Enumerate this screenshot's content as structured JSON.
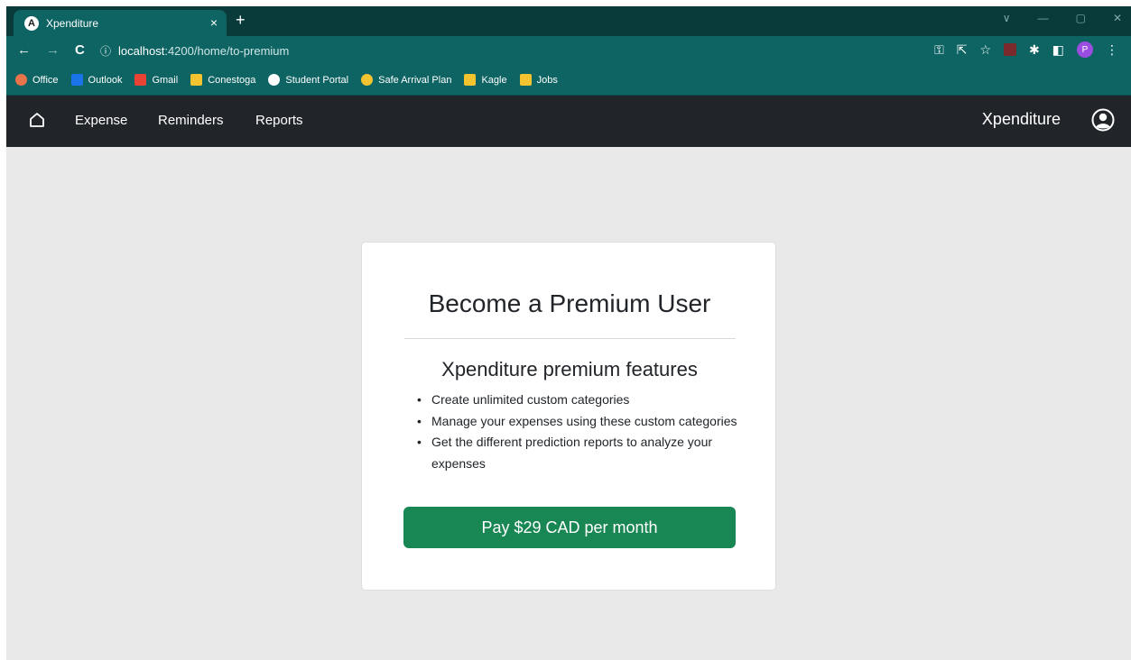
{
  "browser": {
    "tab_title": "Xpenditure",
    "tab_favicon": "A",
    "tab_close": "×",
    "new_tab": "+",
    "url_host": "localhost",
    "url_path": ":4200/home/to-premium",
    "profile_initial": "P",
    "bookmarks": [
      {
        "label": "Office",
        "icon": "office-icon",
        "color": "#e9734a"
      },
      {
        "label": "Outlook",
        "icon": "outlook-icon",
        "color": "#1a73e8"
      },
      {
        "label": "Gmail",
        "icon": "gmail-icon",
        "color": "#ea4335"
      },
      {
        "label": "Conestoga",
        "icon": "folder-icon",
        "color": "#f4c430"
      },
      {
        "label": "Student Portal",
        "icon": "globe-icon",
        "color": "#ffffff"
      },
      {
        "label": "Safe Arrival Plan",
        "icon": "loading-icon",
        "color": "#f4c430"
      },
      {
        "label": "Kagle",
        "icon": "folder-icon",
        "color": "#f4c430"
      },
      {
        "label": "Jobs",
        "icon": "folder-icon",
        "color": "#f4c430"
      }
    ]
  },
  "navbar": {
    "links": [
      "Expense",
      "Reminders",
      "Reports"
    ],
    "brand": "Xpenditure"
  },
  "card": {
    "title": "Become a Premium User",
    "subtitle": "Xpenditure premium features",
    "features": [
      "Create unlimited custom categories",
      "Manage your expenses using these custom categories",
      "Get the different prediction reports to analyze your expenses"
    ],
    "button_label": "Pay $29 CAD per month",
    "button_color": "#198754"
  }
}
